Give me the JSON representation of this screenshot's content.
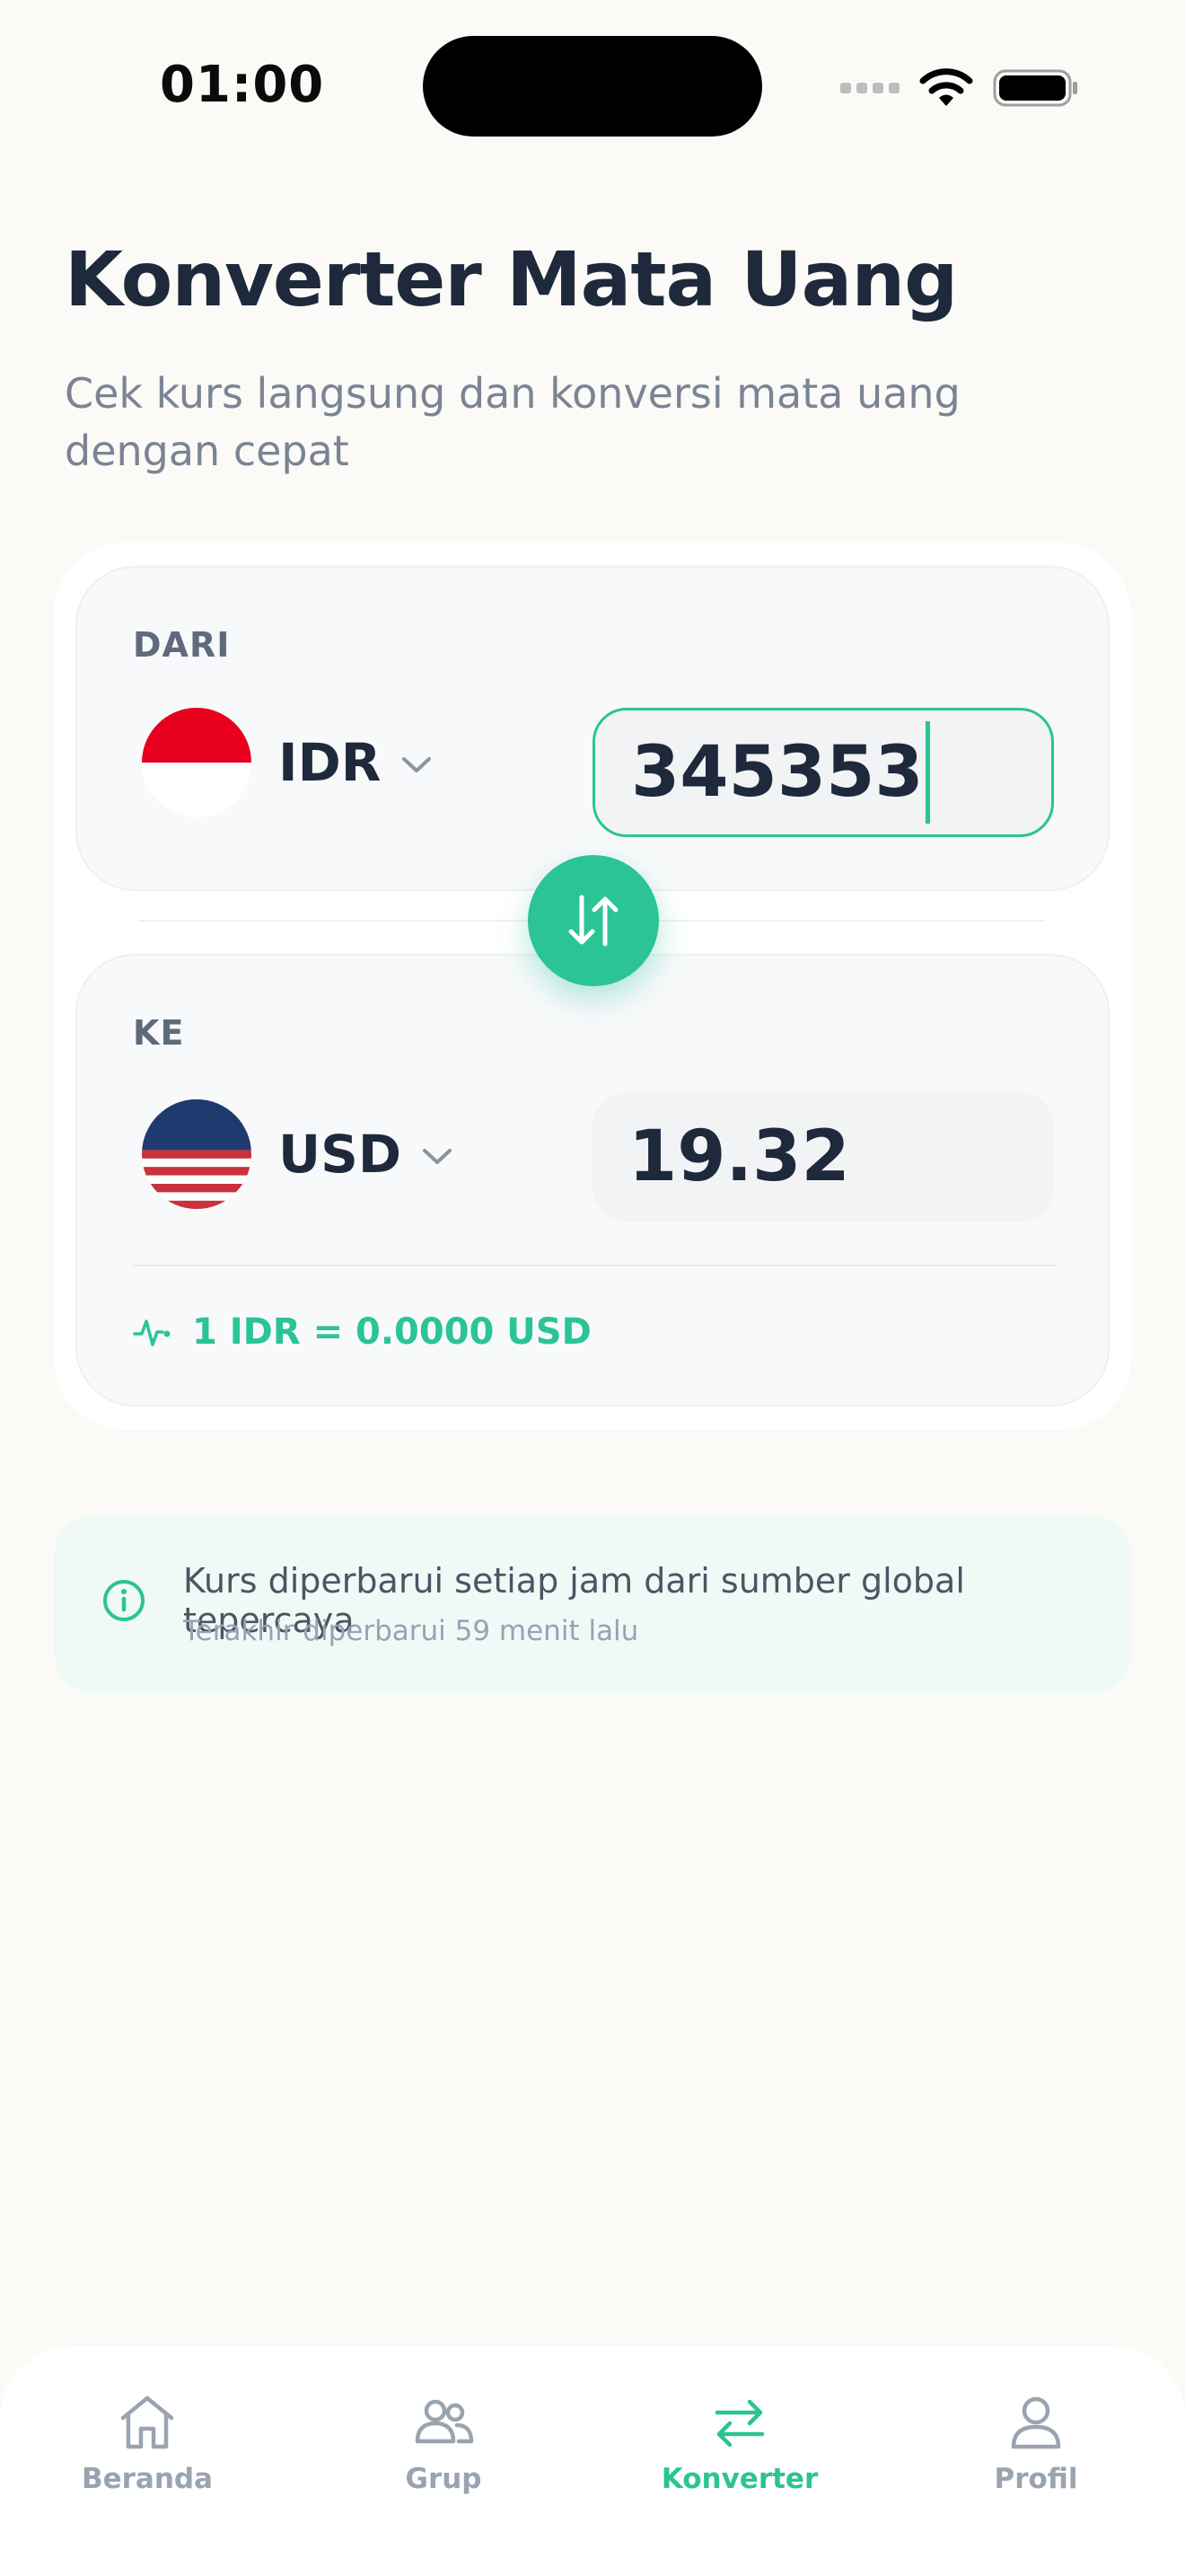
{
  "status_bar": {
    "time": "01:00"
  },
  "header": {
    "title": "Konverter Mata Uang",
    "subtitle": "Cek kurs langsung dan konversi mata uang dengan cepat"
  },
  "converter": {
    "from": {
      "label": "DARI",
      "currency": "IDR",
      "flag_icon": "indonesia-flag-icon",
      "amount": "345353"
    },
    "to": {
      "label": "KE",
      "currency": "USD",
      "flag_icon": "usa-flag-icon",
      "amount": "19.32"
    },
    "rate_text": "1 IDR = 0.0000 USD",
    "accent_color": "#2bc494"
  },
  "info": {
    "title": "Kurs diperbarui setiap jam dari sumber global tepercaya",
    "subtitle": "Terakhir diperbarui 59 menit lalu"
  },
  "tab_bar": {
    "items": [
      {
        "label": "Beranda",
        "icon": "home-icon",
        "active": false
      },
      {
        "label": "Grup",
        "icon": "users-icon",
        "active": false
      },
      {
        "label": "Konverter",
        "icon": "swap-icon",
        "active": true
      },
      {
        "label": "Profil",
        "icon": "user-icon",
        "active": false
      }
    ]
  }
}
